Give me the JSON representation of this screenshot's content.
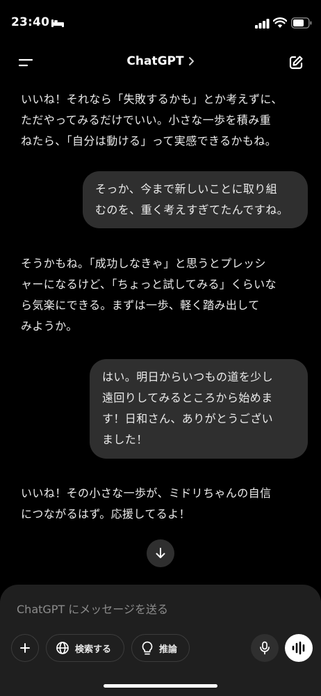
{
  "status_bar": {
    "time": "23:40",
    "icons": [
      "sleep-icon",
      "signal-icon",
      "wifi-icon",
      "battery-icon"
    ]
  },
  "header": {
    "title": "ChatGPT",
    "menu_icon": "menu-icon",
    "title_icon": "chevron-right-icon",
    "compose_icon": "new-chat-icon"
  },
  "messages": [
    {
      "role": "assistant",
      "text": "いいね！それなら「失敗するかも」とか考えずに、\nただやってみるだけでいい。小さな一歩を積み重\nねたら、「自分は動ける」って実感できるかもね。"
    },
    {
      "role": "user",
      "text": "そっか、今まで新しいことに取り組\nむのを、重く考えすぎてたんですね。"
    },
    {
      "role": "assistant",
      "text": "そうかもね。「成功しなきゃ」と思うとプレッシ\nャーになるけど、「ちょっと試してみる」くらいな\nら気楽にできる。まずは一歩、軽く踏み出して\nみようか。"
    },
    {
      "role": "user",
      "text": "はい。明日からいつもの道を少し\n遠回りしてみるところから始めま\nす！日和さん、ありがとうござい\nました！"
    },
    {
      "role": "assistant",
      "text": "いいね！その小さな一歩が、ミドリちゃんの自信\nにつながるはず。応援してるよ！"
    }
  ],
  "scroll_button_icon": "arrow-down-icon",
  "composer": {
    "placeholder": "ChatGPT にメッセージを送る",
    "value": "",
    "attach_icon": "plus-icon",
    "search_label": "検索する",
    "search_icon": "globe-icon",
    "reason_label": "推論",
    "reason_icon": "lightbulb-icon",
    "mic_icon": "microphone-icon",
    "voice_icon": "voice-waveform-icon"
  },
  "colors": {
    "background": "#000000",
    "user_bubble": "#2f2f2f",
    "composer": "#1f1f1f",
    "text": "#ececec",
    "placeholder": "#8c8c8c"
  }
}
